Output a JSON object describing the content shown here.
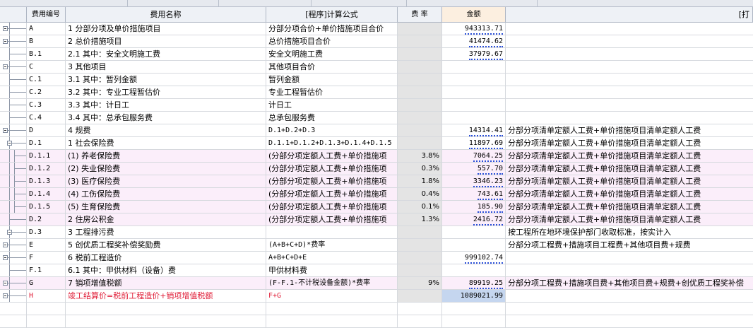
{
  "columns": {
    "code": "费用编号",
    "name": "费用名称",
    "formula": "[程序]计算公式",
    "rate": "费 率",
    "amount": "金额",
    "basis": "[打"
  },
  "rows": [
    {
      "code": "A",
      "name": "1 分部分项及单价措施项目",
      "formula": "分部分项合价+单价措施项目合价",
      "rate": "",
      "amount": "943313.71",
      "basis": ""
    },
    {
      "code": "B",
      "name": "2 总价措施项目",
      "formula": "总价措施项目合价",
      "rate": "",
      "amount": "41474.62",
      "basis": ""
    },
    {
      "code": "B.1",
      "name": "2.1 其中：安全文明施工费",
      "formula": "安全文明施工费",
      "rate": "",
      "amount": "37979.67",
      "basis": ""
    },
    {
      "code": "C",
      "name": "3 其他项目",
      "formula": "其他项目合价",
      "rate": "",
      "amount": "",
      "basis": ""
    },
    {
      "code": "C.1",
      "name": "3.1 其中：暂列金额",
      "formula": "暂列金额",
      "rate": "",
      "amount": "",
      "basis": ""
    },
    {
      "code": "C.2",
      "name": "3.2 其中：专业工程暂估价",
      "formula": "专业工程暂估价",
      "rate": "",
      "amount": "",
      "basis": ""
    },
    {
      "code": "C.3",
      "name": "3.3 其中：计日工",
      "formula": "计日工",
      "rate": "",
      "amount": "",
      "basis": ""
    },
    {
      "code": "C.4",
      "name": "3.4 其中：总承包服务费",
      "formula": "总承包服务费",
      "rate": "",
      "amount": "",
      "basis": ""
    },
    {
      "code": "D",
      "name": "4 规费",
      "formula": "D.1+D.2+D.3",
      "rate": "",
      "amount": "14314.41",
      "basis": "分部分项清单定额人工费+单价措施项目清单定额人工费"
    },
    {
      "code": "D.1",
      "name": "1 社会保险费",
      "formula": "D.1.1+D.1.2+D.1.3+D.1.4+D.1.5",
      "rate": "",
      "amount": "11897.69",
      "basis": "分部分项清单定额人工费+单价措施项目清单定额人工费"
    },
    {
      "code": "D.1.1",
      "name": "(1) 养老保险费",
      "formula": "(分部分项定额人工费+单价措施项",
      "rate": "3.8%",
      "amount": "7064.25",
      "basis": "分部分项清单定额人工费+单价措施项目清单定额人工费"
    },
    {
      "code": "D.1.2",
      "name": "(2) 失业保险费",
      "formula": "(分部分项定额人工费+单价措施项",
      "rate": "0.3%",
      "amount": "557.70",
      "basis": "分部分项清单定额人工费+单价措施项目清单定额人工费"
    },
    {
      "code": "D.1.3",
      "name": "(3) 医疗保险费",
      "formula": "(分部分项定额人工费+单价措施项",
      "rate": "1.8%",
      "amount": "3346.23",
      "basis": "分部分项清单定额人工费+单价措施项目清单定额人工费"
    },
    {
      "code": "D.1.4",
      "name": "(4) 工伤保险费",
      "formula": "(分部分项定额人工费+单价措施项",
      "rate": "0.4%",
      "amount": "743.61",
      "basis": "分部分项清单定额人工费+单价措施项目清单定额人工费"
    },
    {
      "code": "D.1.5",
      "name": "(5) 生育保险费",
      "formula": "(分部分项定额人工费+单价措施项",
      "rate": "0.1%",
      "amount": "185.90",
      "basis": "分部分项清单定额人工费+单价措施项目清单定额人工费"
    },
    {
      "code": "D.2",
      "name": "2 住房公积金",
      "formula": "(分部分项定额人工费+单价措施项",
      "rate": "1.3%",
      "amount": "2416.72",
      "basis": "分部分项清单定额人工费+单价措施项目清单定额人工费"
    },
    {
      "code": "D.3",
      "name": "3 工程排污费",
      "formula": "",
      "rate": "",
      "amount": "",
      "basis": "按工程所在地环境保护部门收取标准，按实计入"
    },
    {
      "code": "E",
      "name": "5 创优质工程奖补偿奖励费",
      "formula": "(A+B+C+D)*费率",
      "rate": "",
      "amount": "",
      "basis": "分部分项工程费+措施项目工程费+其他项目费+规费"
    },
    {
      "code": "F",
      "name": "6 税前工程造价",
      "formula": "A+B+C+D+E",
      "rate": "",
      "amount": "999102.74",
      "basis": ""
    },
    {
      "code": "F.1",
      "name": "6.1 其中：甲供材料（设备）费",
      "formula": "甲供材料费",
      "rate": "",
      "amount": "",
      "basis": ""
    },
    {
      "code": "G",
      "name": "7 销项增值税额",
      "formula": "(F-F.1-不计税设备金额)*费率",
      "rate": "9%",
      "amount": "89919.25",
      "basis": "分部分项工程费+措施项目费+其他项目费+规费+创优质工程奖补偿"
    },
    {
      "code": "H",
      "name": "竣工结算价=税前工程造价+销项增值税额",
      "formula": "F+G",
      "rate": "",
      "amount": "1089021.99",
      "basis": ""
    }
  ],
  "colors": {
    "pink_row": "#fbeefa",
    "red_text": "#e0203a",
    "amount_underline": "#2a4fd8"
  },
  "icons": {
    "toggle": "tree-collapse-icon"
  }
}
